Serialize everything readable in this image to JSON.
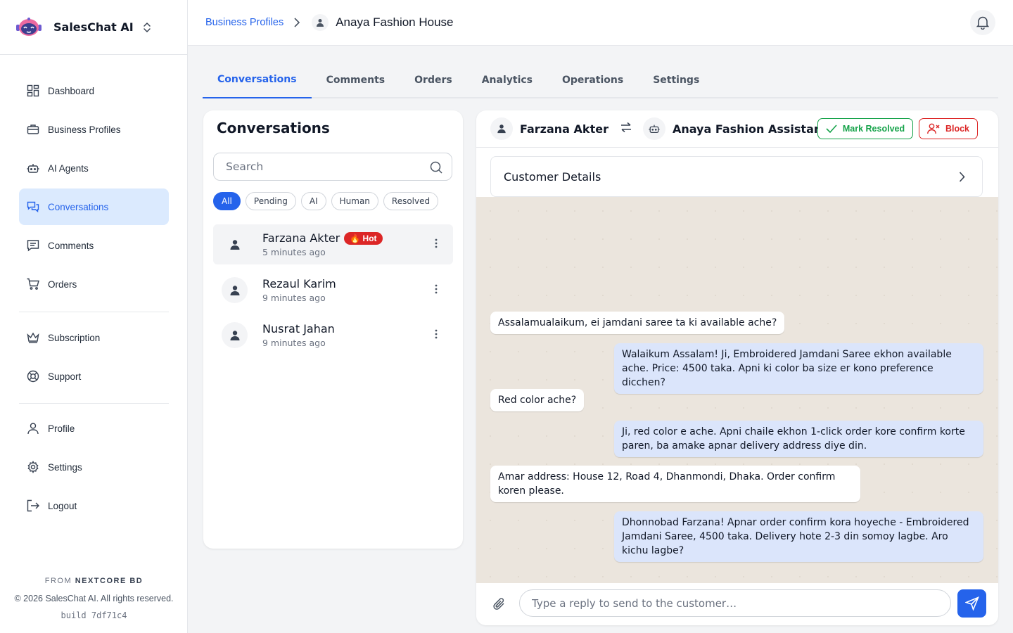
{
  "brand": {
    "name": "SalesChat AI"
  },
  "sidebar": {
    "items": [
      {
        "label": "Dashboard",
        "icon": "dashboard-icon"
      },
      {
        "label": "Business Profiles",
        "icon": "briefcase-icon"
      },
      {
        "label": "AI Agents",
        "icon": "robot-icon"
      },
      {
        "label": "Conversations",
        "icon": "chat-icon",
        "active": true
      },
      {
        "label": "Comments",
        "icon": "comment-icon"
      },
      {
        "label": "Orders",
        "icon": "cart-icon"
      }
    ],
    "items2": [
      {
        "label": "Subscription",
        "icon": "crown-icon"
      },
      {
        "label": "Support",
        "icon": "lifebuoy-icon"
      }
    ],
    "items3": [
      {
        "label": "Profile",
        "icon": "user-icon"
      },
      {
        "label": "Settings",
        "icon": "gear-icon"
      },
      {
        "label": "Logout",
        "icon": "logout-icon"
      }
    ],
    "footer": {
      "from_prefix": "FROM",
      "from_company": "NEXTCORE BD",
      "copyright": "© 2026 SalesChat AI. All rights reserved.",
      "build": "build 7df71c4"
    }
  },
  "header": {
    "breadcrumb_link": "Business Profiles",
    "breadcrumb_current": "Anaya Fashion House"
  },
  "tabs": [
    "Conversations",
    "Comments",
    "Orders",
    "Analytics",
    "Operations",
    "Settings"
  ],
  "conversations_panel": {
    "title": "Conversations",
    "search_placeholder": "Search",
    "filters": [
      "All",
      "Pending",
      "AI",
      "Human",
      "Resolved"
    ],
    "items": [
      {
        "name": "Farzana Akter",
        "time": "5 minutes ago",
        "badge": "🔥 Hot"
      },
      {
        "name": "Rezaul Karim",
        "time": "9 minutes ago"
      },
      {
        "name": "Nusrat Jahan",
        "time": "9 minutes ago"
      }
    ]
  },
  "chat": {
    "customer_name": "Farzana Akter",
    "assistant_name": "Anaya Fashion Assistant",
    "mark_resolved_label": "Mark Resolved",
    "block_label": "Block",
    "customer_details_label": "Customer Details",
    "messages": [
      {
        "from": "customer",
        "text": "Assalamualaikum, ei jamdani saree ta ki available ache?"
      },
      {
        "from": "assistant",
        "text": "Walaikum Assalam! Ji, Embroidered Jamdani Saree ekhon available ache. Price: 4500 taka. Apni ki color ba size er kono preference dicchen?"
      },
      {
        "from": "customer",
        "text": "Red color ache?"
      },
      {
        "from": "assistant",
        "text": "Ji, red color e ache. Apni chaile ekhon 1-click order kore confirm korte paren, ba amake apnar delivery address diye din."
      },
      {
        "from": "customer",
        "text": "Amar address: House 12, Road 4, Dhanmondi, Dhaka. Order confirm koren please."
      },
      {
        "from": "assistant",
        "text": "Dhonnobad Farzana! Apnar order confirm kora hoyeche - Embroidered Jamdani Saree, 4500 taka. Delivery hote 2-3 din somoy lagbe. Aro kichu lagbe?"
      }
    ],
    "reply_placeholder": "Type a reply to send to the customer…"
  },
  "colors": {
    "accent": "#2563eb",
    "active_nav_bg": "#dbeafe",
    "resolve_green": "#16a34a",
    "block_red": "#dc2626",
    "chat_bg": "#ebe5dd",
    "outgoing_bubble": "#dbe5fb"
  }
}
